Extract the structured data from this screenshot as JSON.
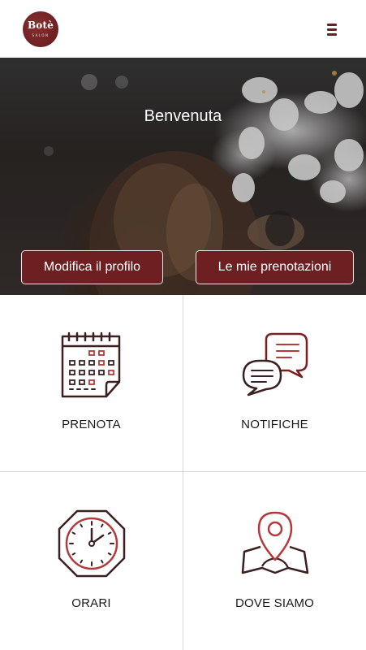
{
  "header": {
    "logo_text": "Botè",
    "logo_subtext": "SALON",
    "menu_icon": "hamburger-menu-icon",
    "accent_color": "#6e1f22"
  },
  "hero": {
    "title": "Benvenuta",
    "buttons": {
      "edit_profile": "Modifica il profilo",
      "my_bookings": "Le mie prenotazioni"
    }
  },
  "tiles": [
    {
      "label": "PRENOTA",
      "icon": "calendar-icon"
    },
    {
      "label": "NOTIFICHE",
      "icon": "chat-bubbles-icon"
    },
    {
      "label": "ORARI",
      "icon": "clock-icon"
    },
    {
      "label": "DOVE SIAMO",
      "icon": "map-pin-icon"
    }
  ]
}
